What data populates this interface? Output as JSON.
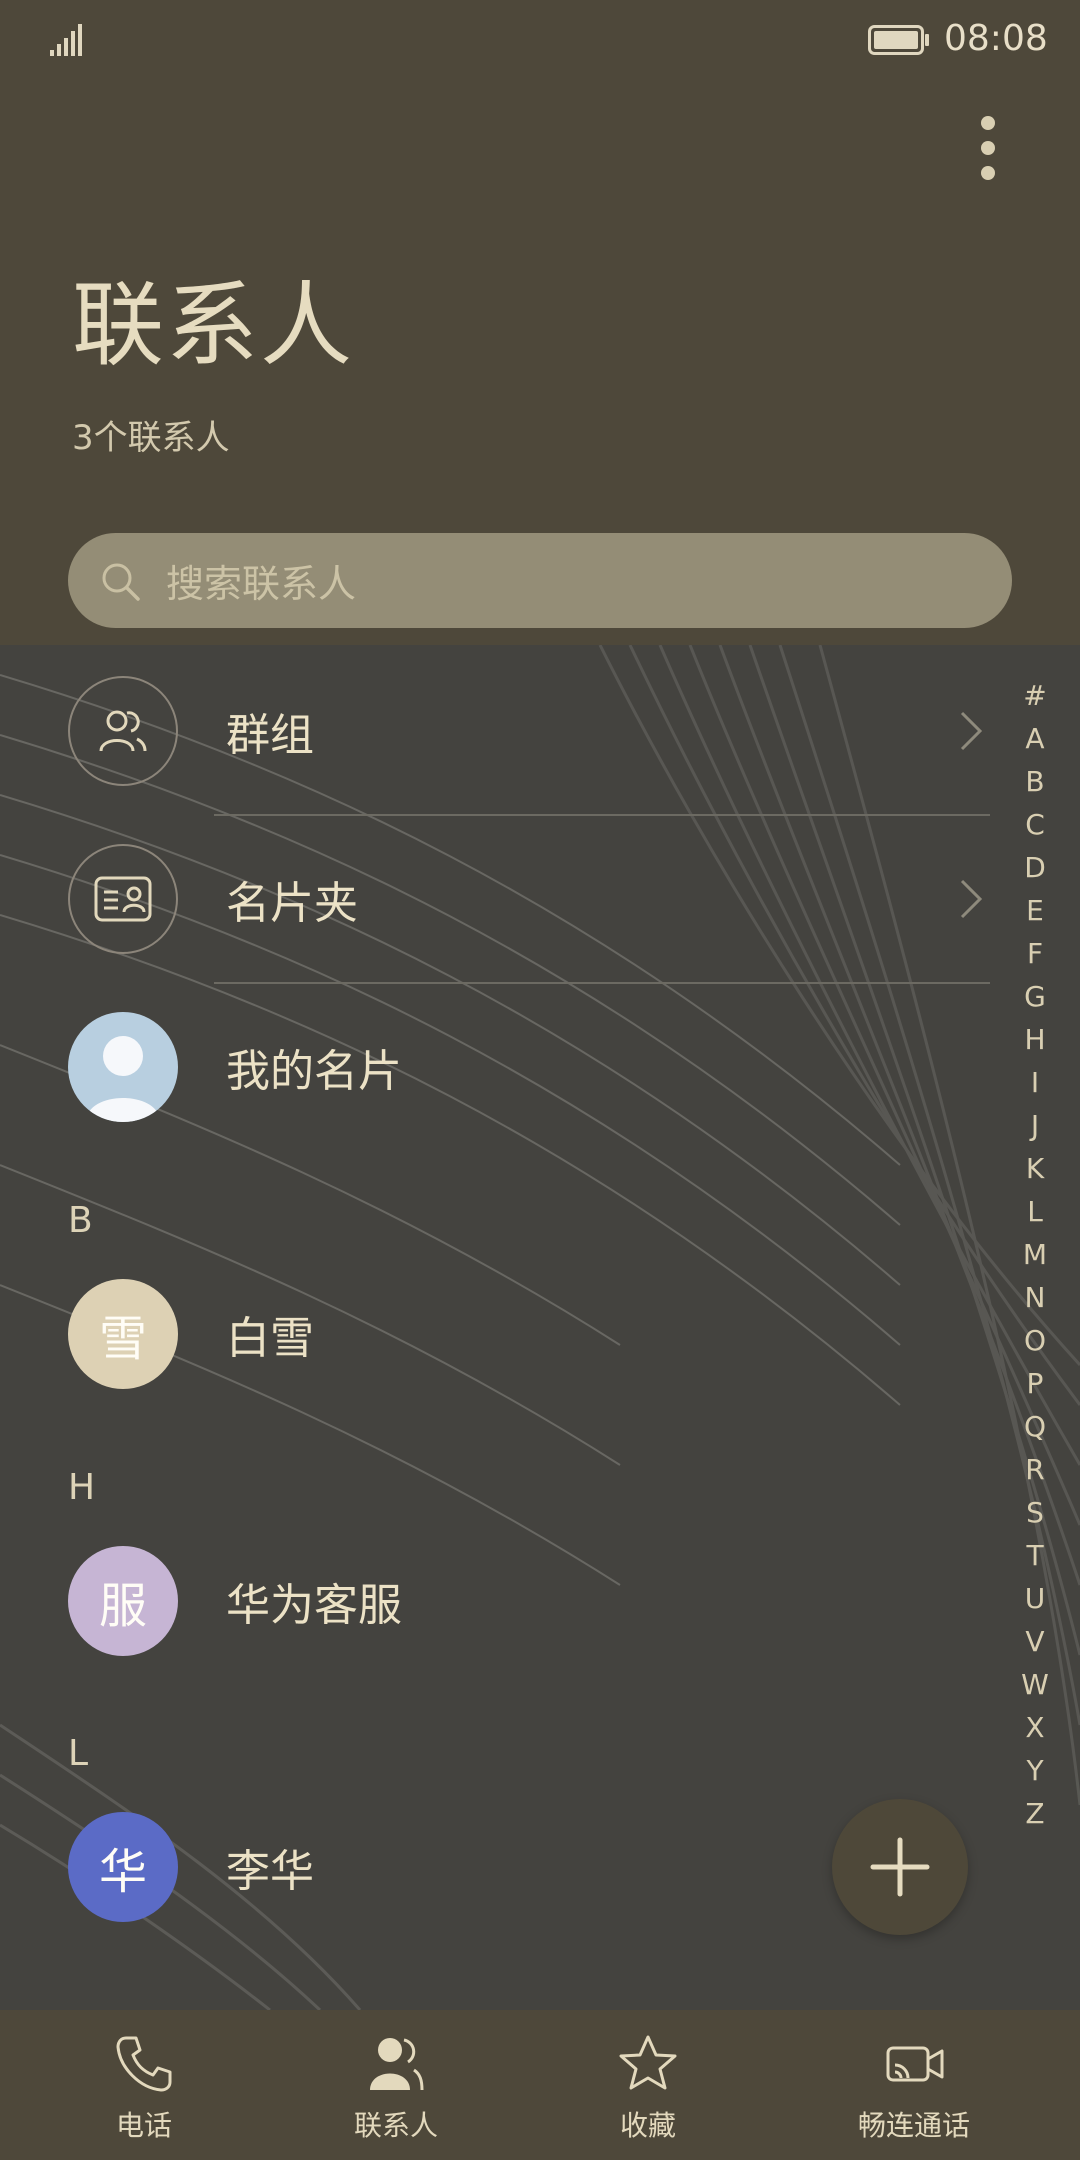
{
  "status_bar": {
    "time": "08:08"
  },
  "header": {
    "title": "联系人",
    "subtitle": "3个联系人",
    "more_icon": "more-vertical-icon"
  },
  "search": {
    "placeholder": "搜索联系人",
    "icon": "search-icon"
  },
  "entries": [
    {
      "label": "群组",
      "icon": "group-icon"
    },
    {
      "label": "名片夹",
      "icon": "business-card-icon"
    },
    {
      "label": "我的名片",
      "icon": "person-avatar-icon"
    }
  ],
  "sections": [
    {
      "letter": "B",
      "contacts": [
        {
          "name": "白雪",
          "avatar_char": "雪",
          "color": "#ddd1b4"
        }
      ]
    },
    {
      "letter": "H",
      "contacts": [
        {
          "name": "华为客服",
          "avatar_char": "服",
          "color": "#c6b5d4"
        }
      ]
    },
    {
      "letter": "L",
      "contacts": [
        {
          "name": "李华",
          "avatar_char": "华",
          "color": "#5b6bc6"
        }
      ]
    }
  ],
  "alphabet": [
    "#",
    "A",
    "B",
    "C",
    "D",
    "E",
    "F",
    "G",
    "H",
    "I",
    "J",
    "K",
    "L",
    "M",
    "N",
    "O",
    "P",
    "Q",
    "R",
    "S",
    "T",
    "U",
    "V",
    "W",
    "X",
    "Y",
    "Z"
  ],
  "fab": {
    "icon": "plus-icon"
  },
  "nav": [
    {
      "label": "电话",
      "icon": "phone-icon"
    },
    {
      "label": "联系人",
      "icon": "contacts-icon",
      "active": true
    },
    {
      "label": "收藏",
      "icon": "star-icon"
    },
    {
      "label": "畅连通话",
      "icon": "video-call-icon"
    }
  ],
  "colors": {
    "header_bg": "#4e483a",
    "accent_text": "#e6dcc0",
    "search_bg": "#948d76",
    "list_bg": "#44433f"
  }
}
